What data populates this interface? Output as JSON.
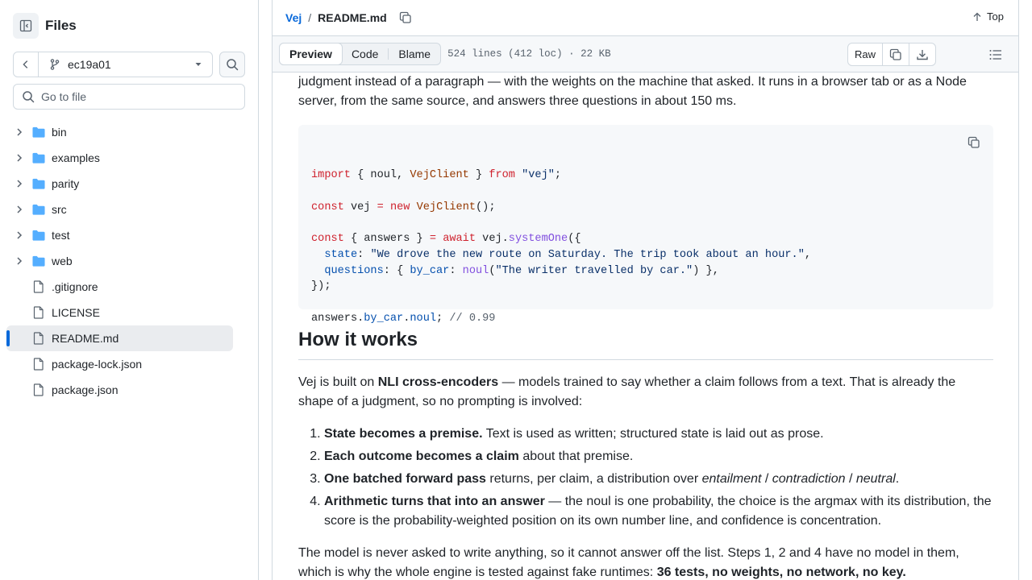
{
  "sidebar": {
    "title": "Files",
    "branch": "ec19a01",
    "goto_placeholder": "Go to file",
    "tree": [
      {
        "type": "folder",
        "label": "bin"
      },
      {
        "type": "folder",
        "label": "examples"
      },
      {
        "type": "folder",
        "label": "parity"
      },
      {
        "type": "folder",
        "label": "src"
      },
      {
        "type": "folder",
        "label": "test"
      },
      {
        "type": "folder",
        "label": "web"
      },
      {
        "type": "file",
        "label": ".gitignore"
      },
      {
        "type": "file",
        "label": "LICENSE"
      },
      {
        "type": "file",
        "label": "README.md",
        "selected": true
      },
      {
        "type": "file",
        "label": "package-lock.json"
      },
      {
        "type": "file",
        "label": "package.json"
      }
    ]
  },
  "header": {
    "repo": "Vej",
    "separator": "/",
    "file": "README.md",
    "top_label": "Top"
  },
  "filebar": {
    "tabs": [
      "Preview",
      "Code",
      "Blame"
    ],
    "active_tab": "Preview",
    "meta": "524 lines (412 loc) · 22 KB",
    "raw_label": "Raw"
  },
  "readme": {
    "intro": "judgment instead of a paragraph — with the weights on the machine that asked. It runs in a browser tab or as a Node server, from the same source, and answers three questions in about 150 ms.",
    "code_lines": [
      [
        [
          "k",
          "import"
        ],
        [
          "t",
          " { noul, "
        ],
        [
          "c",
          "VejClient"
        ],
        [
          "t",
          " } "
        ],
        [
          "k",
          "from"
        ],
        [
          "t",
          " "
        ],
        [
          "s",
          "\"vej\""
        ],
        [
          "t",
          ";"
        ]
      ],
      [],
      [
        [
          "k",
          "const"
        ],
        [
          "t",
          " vej "
        ],
        [
          "k",
          "="
        ],
        [
          "t",
          " "
        ],
        [
          "k",
          "new"
        ],
        [
          "t",
          " "
        ],
        [
          "c",
          "VejClient"
        ],
        [
          "t",
          "();"
        ]
      ],
      [],
      [
        [
          "k",
          "const"
        ],
        [
          "t",
          " { answers } "
        ],
        [
          "k",
          "="
        ],
        [
          "t",
          " "
        ],
        [
          "k",
          "await"
        ],
        [
          "t",
          " vej."
        ],
        [
          "f",
          "systemOne"
        ],
        [
          "t",
          "({"
        ]
      ],
      [
        [
          "t",
          "  "
        ],
        [
          "p",
          "state"
        ],
        [
          "t",
          ": "
        ],
        [
          "s",
          "\"We drove the new route on Saturday. The trip took about an hour.\""
        ],
        [
          "t",
          ","
        ]
      ],
      [
        [
          "t",
          "  "
        ],
        [
          "p",
          "questions"
        ],
        [
          "t",
          ": { "
        ],
        [
          "p",
          "by_car"
        ],
        [
          "t",
          ": "
        ],
        [
          "f",
          "noul"
        ],
        [
          "t",
          "("
        ],
        [
          "s",
          "\"The writer travelled by car.\""
        ],
        [
          "t",
          ") },"
        ]
      ],
      [
        [
          "t",
          "});"
        ]
      ],
      [],
      [
        [
          "t",
          "answers."
        ],
        [
          "p",
          "by_car"
        ],
        [
          "t",
          "."
        ],
        [
          "p",
          "noul"
        ],
        [
          "t",
          "; "
        ],
        [
          "cm",
          "// 0.99"
        ]
      ]
    ],
    "heading": "How it works",
    "p1_pre": "Vej is built on ",
    "p1_bold": "NLI cross-encoders",
    "p1_post": " — models trained to say whether a claim follows from a text. That is already the shape of a judgment, so no prompting is involved:",
    "steps": [
      {
        "bold": "State becomes a premise.",
        "rest": " Text is used as written; structured state is laid out as prose."
      },
      {
        "bold": "Each outcome becomes a claim",
        "rest": " about that premise."
      },
      {
        "bold": "One batched forward pass",
        "rest": " returns, per claim, a distribution over ",
        "i1": "entailment",
        "sep1": " / ",
        "i2": "contradiction",
        "sep2": " / ",
        "i3": "neutral",
        "end": "."
      },
      {
        "bold": "Arithmetic turns that into an answer",
        "rest": " — the noul is one probability, the choice is the argmax with its distribution, the score is the probability-weighted position on its own number line, and confidence is concentration."
      }
    ],
    "p2_pre": "The model is never asked to write anything, so it cannot answer off the list. Steps 1, 2 and 4 have no model in them, which is why the whole engine is tested against fake runtimes: ",
    "p2_bold": "36 tests, no weights, no network, no key."
  },
  "colors": {
    "accent": "#0969da",
    "folder": "#54aeff",
    "border": "#d1d9e0"
  }
}
